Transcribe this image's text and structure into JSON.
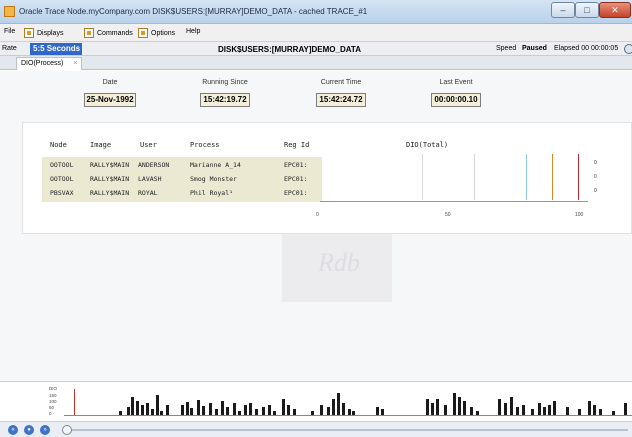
{
  "window": {
    "title": "Oracle Trace Node.myCompany.com DISK$USERS:[MURRAY]DEMO_DATA - cached TRACE_#1",
    "min_glyph": "–",
    "max_glyph": "□",
    "close_glyph": "✕"
  },
  "menu": {
    "file": "File",
    "displays": "Displays",
    "commands": "Commands",
    "options": "Options",
    "help": "Help"
  },
  "status": {
    "rate_label": "Rate",
    "rate_value": "5:5 Seconds",
    "source": "DISK$USERS:[MURRAY]DEMO_DATA",
    "speed_label": "Speed",
    "state": "Paused",
    "elapsed": "Elapsed 00 00:00:05"
  },
  "tab": {
    "label": "DIO(Process)",
    "close_glyph": "×"
  },
  "info": {
    "date_label": "Date",
    "date_value": "25-Nov-1992",
    "running_label": "Running Since",
    "running_value": "15:42:19.72",
    "current_label": "Current Time",
    "current_value": "15:42:24.72",
    "last_label": "Last Event",
    "last_value": "00:00:00.10"
  },
  "table": {
    "headers": {
      "node": "Node",
      "image": "Image",
      "user": "User",
      "process": "Process",
      "reg": "Reg Id",
      "dio": "DIO(Total)"
    },
    "rows": [
      {
        "node": "OOTOOL",
        "image": "RALLY$MAIN",
        "user": "ANDERSON",
        "process": "Marianne A_14",
        "reg": "EPC01:"
      },
      {
        "node": "OOTOOL",
        "image": "RALLY$MAIN",
        "user": "LAVASH",
        "process": "Smog Monster",
        "reg": "EPC01:"
      },
      {
        "node": "PBSVAX",
        "image": "RALLY$MAIN",
        "user": "ROYAL",
        "process": "Phil Royal¹",
        "reg": "EPC01:"
      }
    ],
    "row_values": [
      "0",
      "0",
      "0"
    ],
    "axis_ticks": [
      "0",
      "50",
      "100"
    ]
  },
  "timeline": {
    "axis_label": "DIO",
    "axis_ticks": [
      "150",
      "100",
      "50",
      "0"
    ]
  },
  "controls": {
    "rewind_glyph": "«",
    "play_glyph": "●",
    "forward_glyph": "»"
  },
  "colors": {
    "rate_highlight": "#2f68c8",
    "row_background": "#ece9d3",
    "dio_line_blue": "#8cc8e8",
    "dio_line_orange": "#d58a26",
    "dio_line_red": "#b52a2a"
  }
}
